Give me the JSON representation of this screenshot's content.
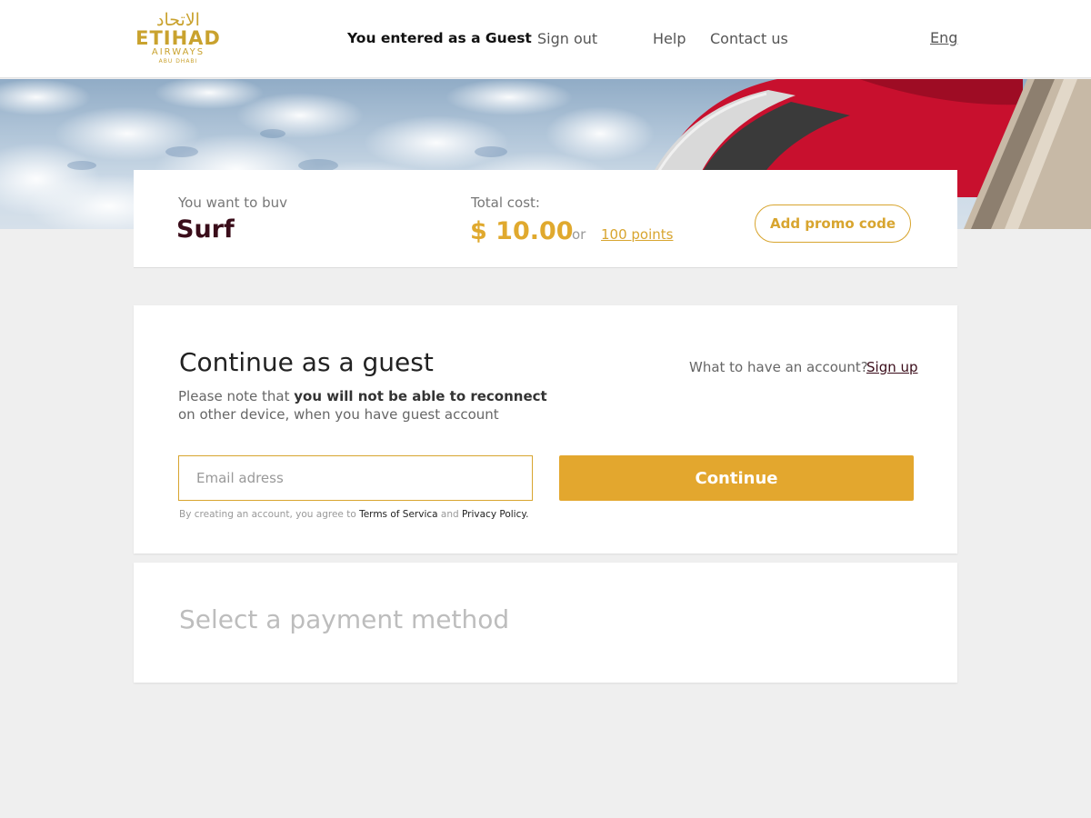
{
  "header": {
    "logo": {
      "arabic": "الاتحاد",
      "main": "ETIHAD",
      "sub": "AIRWAYS",
      "sub2": "ABU DHABI"
    },
    "nav": {
      "guest_status": "You entered as a Guest",
      "sign_out": "Sign out",
      "help": "Help",
      "contact": "Contact us",
      "language": "Eng"
    }
  },
  "summary": {
    "want_label": "You want to buv",
    "product": "Surf",
    "total_label": "Total cost:",
    "price": "$ 10.00",
    "or": "or",
    "points": "100 points",
    "promo_button": "Add promo code"
  },
  "guest": {
    "title": "Continue as a guest",
    "note_prefix": "Please note that ",
    "note_bold": "you will not be able to reconnect",
    "note_suffix": " on other device, when you have guest account",
    "account_question": "What to have an account?",
    "sign_up": "Sign up",
    "email_placeholder": "Email adress",
    "email_value": "",
    "continue_button": "Continue",
    "terms_prefix": "By creating an account, you agree to ",
    "terms_link": "Terms of Servica",
    "terms_and": " and ",
    "privacy_link": "Privacy Policy."
  },
  "payment": {
    "title": "Select a payment method"
  },
  "colors": {
    "accent": "#e3a72e",
    "brand_dark": "#3a0d1a",
    "background": "#efefef"
  }
}
